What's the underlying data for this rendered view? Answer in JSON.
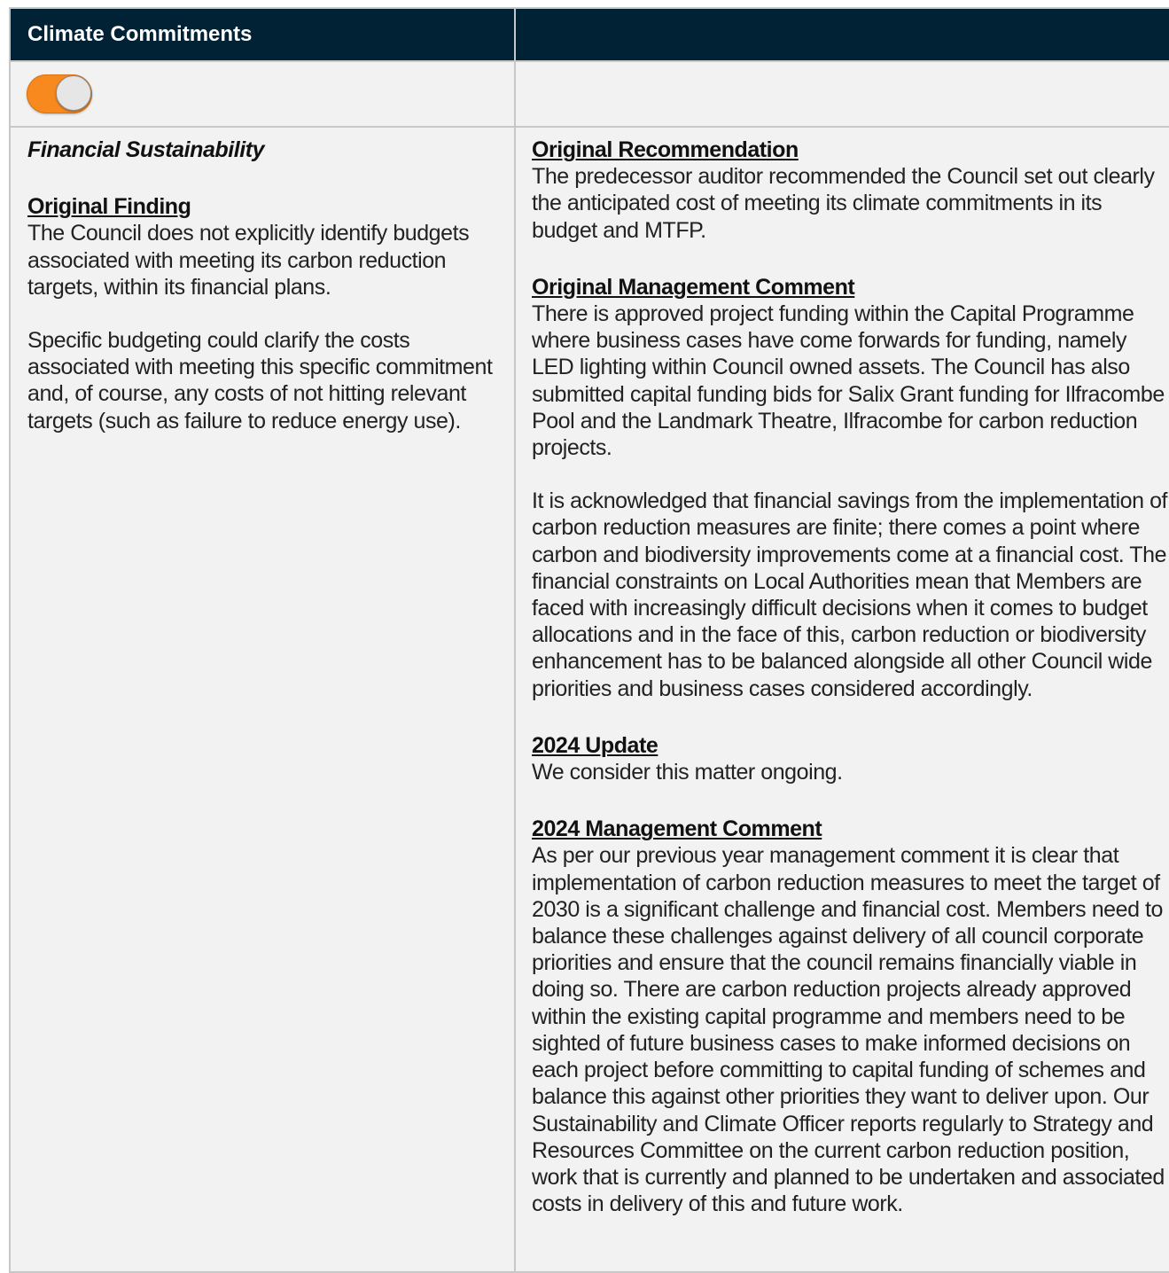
{
  "table": {
    "header": {
      "left_title": "Climate Commitments",
      "right_title": ""
    },
    "toggle": {
      "state": "on",
      "color": "#f7891f"
    },
    "left": {
      "section_title": "Financial Sustainability",
      "original_finding": {
        "heading": "Original Finding",
        "paragraphs": [
          "The Council does not explicitly identify budgets associated with meeting its carbon reduction targets, within its financial plans.",
          "Specific budgeting could clarify the costs associated with meeting this specific commitment and, of course, any costs of not hitting relevant targets (such as failure to reduce energy use)."
        ]
      }
    },
    "right": {
      "original_recommendation": {
        "heading": "Original Recommendation",
        "paragraphs": [
          "The predecessor auditor recommended the Council set out clearly the anticipated cost of meeting its climate commitments in its budget and MTFP."
        ]
      },
      "original_management_comment": {
        "heading": "Original Management Comment",
        "paragraphs": [
          "There is approved project funding within the Capital Programme where business cases have come forwards for funding, namely LED lighting within Council owned assets. The Council has also submitted capital funding bids for Salix Grant funding for Ilfracombe Pool and the Landmark Theatre, Ilfracombe for carbon reduction projects.",
          "It is acknowledged that financial savings from the implementation of carbon reduction measures are finite; there comes a point where carbon and biodiversity improvements come at a financial cost. The financial constraints on Local Authorities mean that Members are faced with increasingly difficult decisions when it comes to budget allocations and in the face of this, carbon reduction or biodiversity enhancement has to be balanced alongside all other Council wide priorities and business cases considered accordingly."
        ]
      },
      "update_2024": {
        "heading": "2024 Update",
        "paragraphs": [
          "We consider this matter ongoing."
        ]
      },
      "management_comment_2024": {
        "heading": "2024 Management Comment",
        "paragraphs": [
          "As per our previous year management comment it is clear that implementation of carbon reduction measures to meet the target of 2030 is a significant challenge and financial cost. Members need to balance these challenges against delivery of all council corporate priorities and ensure that the council remains financially viable in doing so. There are carbon reduction projects already approved within the existing capital programme and members need to be sighted of future business cases to make informed decisions on each project before committing to capital funding of schemes and balance this against other priorities they want to deliver upon. Our Sustainability and Climate Officer reports regularly to Strategy and Resources Committee on the current carbon reduction position, work that is currently and planned to be undertaken and associated costs in delivery of this and future work."
        ]
      }
    }
  }
}
